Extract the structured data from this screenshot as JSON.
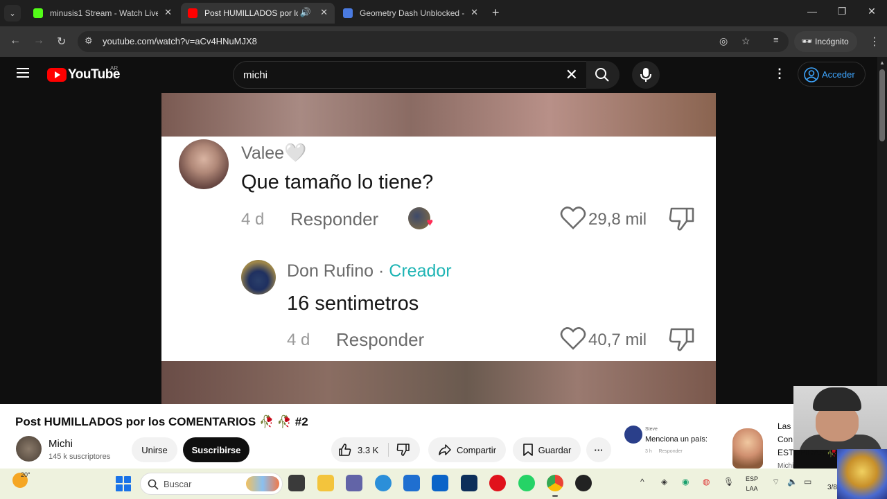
{
  "browser": {
    "tabs": [
      {
        "title": "minusis1 Stream - Watch Live o",
        "active": false,
        "favicon_color": "#53fc18"
      },
      {
        "title": "Post HUMILLADOS por los",
        "active": true,
        "favicon_color": "#ff0000"
      },
      {
        "title": "Geometry Dash Unblocked - Pl",
        "active": false,
        "favicon_color": "#4a7ae0"
      }
    ],
    "url": "youtube.com/watch?v=aCv4HNuMJX8",
    "incognito_label": "Incógnito"
  },
  "youtube": {
    "logo_text": "YouTube",
    "region": "AR",
    "search_value": "michi",
    "signin_label": "Acceder"
  },
  "video_comments": [
    {
      "username": "Valee",
      "text": "Que tamaño lo tiene?",
      "age": "4 d",
      "reply_label": "Responder",
      "likes": "29,8 mil"
    },
    {
      "username": "Don Rufino",
      "separator": " · ",
      "creator_badge": "Creador",
      "text": "16 sentimetros",
      "age": "4 d",
      "reply_label": "Responder",
      "likes": "40,7 mil"
    }
  ],
  "video_info": {
    "title": "Post HUMILLADOS por los COMENTARIOS 🥀 🥀 #2",
    "channel": "Michi",
    "subscribers": "145 k suscriptores",
    "join_label": "Unirse",
    "subscribe_label": "Suscribirse",
    "like_count": "3.3 K",
    "share_label": "Compartir",
    "save_label": "Guardar"
  },
  "related": {
    "user": "Steve",
    "text": "Menciona un país:",
    "age": "3 h",
    "reply": "Responder",
    "side_text_1": "Las",
    "side_text_2": "Con",
    "side_text_3": "ESTUPIDAS 🥀",
    "side_text_4": "Michi"
  },
  "taskbar": {
    "temperature": "20°",
    "search_placeholder": "Buscar",
    "lang_line1": "ESP",
    "lang_line2": "LAA",
    "clock": "3/8"
  },
  "colors": {
    "youtube_red": "#ff0000",
    "link_blue": "#3ea6ff",
    "creator_teal": "#20b5b5"
  }
}
